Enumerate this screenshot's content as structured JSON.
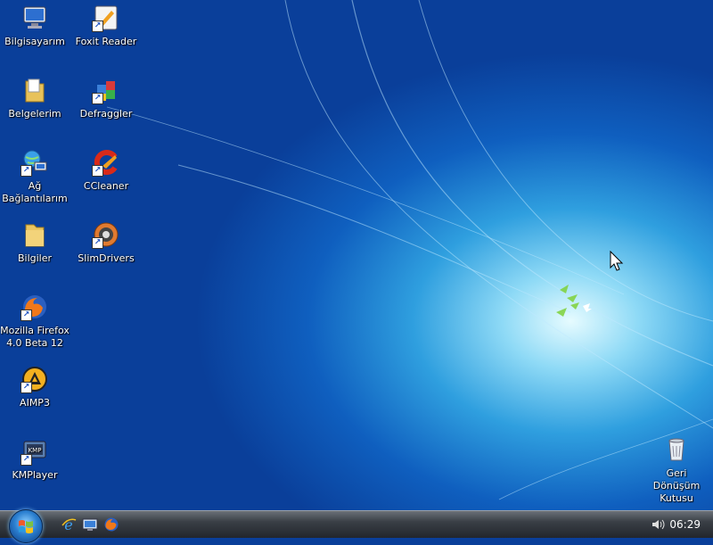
{
  "desktop": {
    "icons_left": [
      {
        "name": "computer-icon",
        "label": "Bilgisayarım"
      },
      {
        "name": "documents-folder-icon",
        "label": "Belgelerim"
      },
      {
        "name": "network-icon",
        "label": "Ağ Bağlantılarım"
      },
      {
        "name": "folder-icon",
        "label": "Bilgiler"
      },
      {
        "name": "firefox-icon",
        "label": "Mozilla Firefox 4.0 Beta 12"
      },
      {
        "name": "aimp-icon",
        "label": "AIMP3"
      },
      {
        "name": "kmplayer-icon",
        "label": "KMPlayer"
      }
    ],
    "icons_right": [
      {
        "name": "foxit-reader-icon",
        "label": "Foxit Reader"
      },
      {
        "name": "defraggler-icon",
        "label": "Defraggler"
      },
      {
        "name": "ccleaner-icon",
        "label": "CCleaner"
      },
      {
        "name": "slimdrivers-icon",
        "label": "SlimDrivers"
      }
    ],
    "recycle_bin": {
      "label": "Geri Dönüşüm Kutusu"
    }
  },
  "taskbar": {
    "clock": "06:29",
    "quick_launch": [
      "ie-icon",
      "show-desktop-icon",
      "firefox-icon"
    ]
  },
  "colors": {
    "taskbar": "#2b2f35",
    "desktop_accent": "#0f5fbf"
  }
}
